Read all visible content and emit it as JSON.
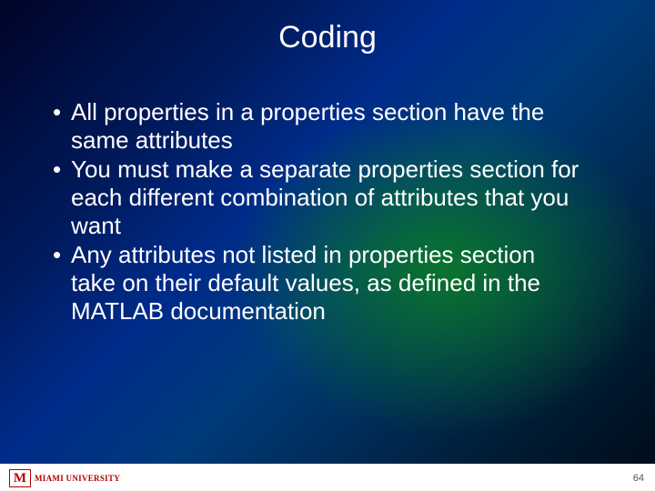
{
  "title": "Coding",
  "bullets": [
    "All properties in a properties section have the same attributes",
    "You must make a separate properties section for each different combination of attributes that you want",
    "Any attributes not listed in properties section take on their default values, as defined in the MATLAB documentation"
  ],
  "logo": {
    "mark": "M",
    "main": "MIAMI UNIVERSITY",
    "sub": ""
  },
  "page_number": "64"
}
